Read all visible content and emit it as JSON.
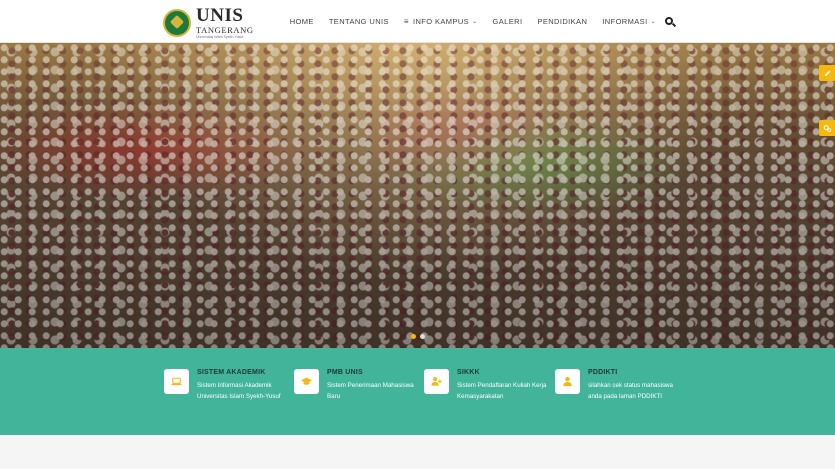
{
  "brand": {
    "name": "UNIS",
    "city": "TANGERANG",
    "tagline": "Universitas Islam Syekh-Yusuf",
    "year": "1 9 9 4",
    "logo_colors": [
      "#1f7a3a",
      "#d6b53a"
    ]
  },
  "nav": {
    "items": [
      {
        "label": "HOME",
        "dropdown": false,
        "icon": null
      },
      {
        "label": "TENTANG UNIS",
        "dropdown": false,
        "icon": null
      },
      {
        "label": "INFO KAMPUS",
        "dropdown": true,
        "icon": "list-icon"
      },
      {
        "label": "GALERI",
        "dropdown": false,
        "icon": null
      },
      {
        "label": "PENDIDIKAN",
        "dropdown": false,
        "icon": null
      },
      {
        "label": "INFORMASI",
        "dropdown": true,
        "icon": null
      }
    ],
    "search_icon": "search-icon"
  },
  "hero": {
    "slides_total": 2,
    "active_slide": 1,
    "dot_colors": {
      "active": "#f5b80e",
      "inactive": "#dddddd"
    },
    "side_buttons": [
      "pencil-icon",
      "gears-icon"
    ]
  },
  "features": [
    {
      "title": "SISTEM AKADEMIK",
      "desc": "Sistem Informasi Akademik Universitas Islam Syekh-Yusuf",
      "icon": "laptop-icon"
    },
    {
      "title": "PMB UNIS",
      "desc": "Sistem Penerimaan Mahasiswa Baru",
      "icon": "graduation-cap-icon"
    },
    {
      "title": "SIKKK",
      "desc": "Sistem Pendaftaran Kuliah Kerja Kemasyarakatan",
      "icon": "user-plus-icon"
    },
    {
      "title": "PDDIKTI",
      "desc": "silahkan cek status mahasiswa anda pada laman PDDIKTI",
      "icon": "user-icon"
    }
  ],
  "colors": {
    "accent": "#41b49a",
    "highlight": "#f5b80e",
    "icon_color": "#f5b80e"
  }
}
